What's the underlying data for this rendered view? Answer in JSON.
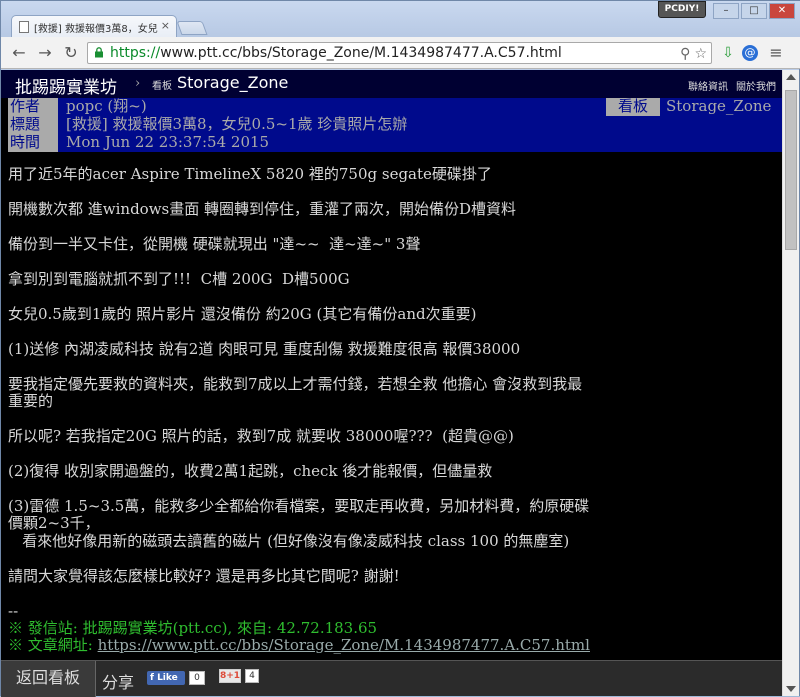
{
  "browser": {
    "tab_title": "[救援] 救援報價3萬8，女兒",
    "tab_close": "×",
    "badge": "PCDIY!",
    "url_scheme": "https://",
    "url_rest": "www.ptt.cc/bbs/Storage_Zone/M.1434987477.A.C57.html",
    "win_min": "–",
    "win_max": "□",
    "win_close": "✕"
  },
  "site": {
    "name": "批踢踢實業坊",
    "separator": "›",
    "board_tag": "看板",
    "board_name": "Storage_Zone",
    "links": [
      "聯絡資訊",
      "關於我們"
    ]
  },
  "meta": {
    "author_label": "作者",
    "author": "popc (翔~)",
    "board_label": "看板",
    "board": "Storage_Zone",
    "title_label": "標題",
    "title": "[救援] 救援報價3萬8，女兒0.5~1歲 珍貴照片怎辦",
    "time_label": "時間",
    "time": "Mon Jun 22 23:37:54 2015"
  },
  "body": {
    "lines": [
      "用了近5年的acer Aspire TimelineX 5820 裡的750g segate硬碟掛了",
      "開機數次都 進windows畫面 轉圈轉到停住，重灌了兩次，開始備份D槽資料",
      "備份到一半又卡住，從開機 硬碟就現出 \"達~~  達~達~\" 3聲",
      "拿到別到電腦就抓不到了!!!  C槽 200G  D槽500G",
      "女兒0.5歲到1歲的 照片影片 還沒備份 約20G (其它有備份and次重要)",
      "(1)送修 內湖凌威科技 說有2道 肉眼可見 重度刮傷 救援難度很高 報價38000",
      "要我指定優先要救的資料夾，能救到7成以上才需付錢，若想全救 他擔心 會沒救到我最",
      "重要的",
      "所以呢? 若我指定20G 照片的話，救到7成 就要收 38000喔???  (超貴@@)",
      "(2)復得 收別家開過盤的，收費2萬1起跳，check 後才能報價，但儘量救",
      "(3)雷德 1.5~3.5萬，能救多少全都給你看檔案，要取走再收費，另加材料費，約原硬碟",
      "價顆2~3千，",
      "   看來他好像用新的磁頭去讀舊的磁片 (但好像沒有像凌威科技 class 100 的無塵室)",
      "請問大家覺得該怎麼樣比較好? 還是再多比其它間呢? 謝謝!"
    ],
    "dashes": "--",
    "sig_from": "※ 發信站: 批踢踢實業坊(ptt.cc), 來自: 42.72.183.65",
    "sig_url_label": "※ 文章網址: ",
    "sig_url": "https://www.ptt.cc/bbs/Storage_Zone/M.1434987477.A.C57.html"
  },
  "bottom": {
    "back_label": "返回看板",
    "share_label": "分享",
    "fb_like": "Like",
    "fb_count": "0",
    "gplus": "8+1",
    "gplus_count": "4"
  }
}
